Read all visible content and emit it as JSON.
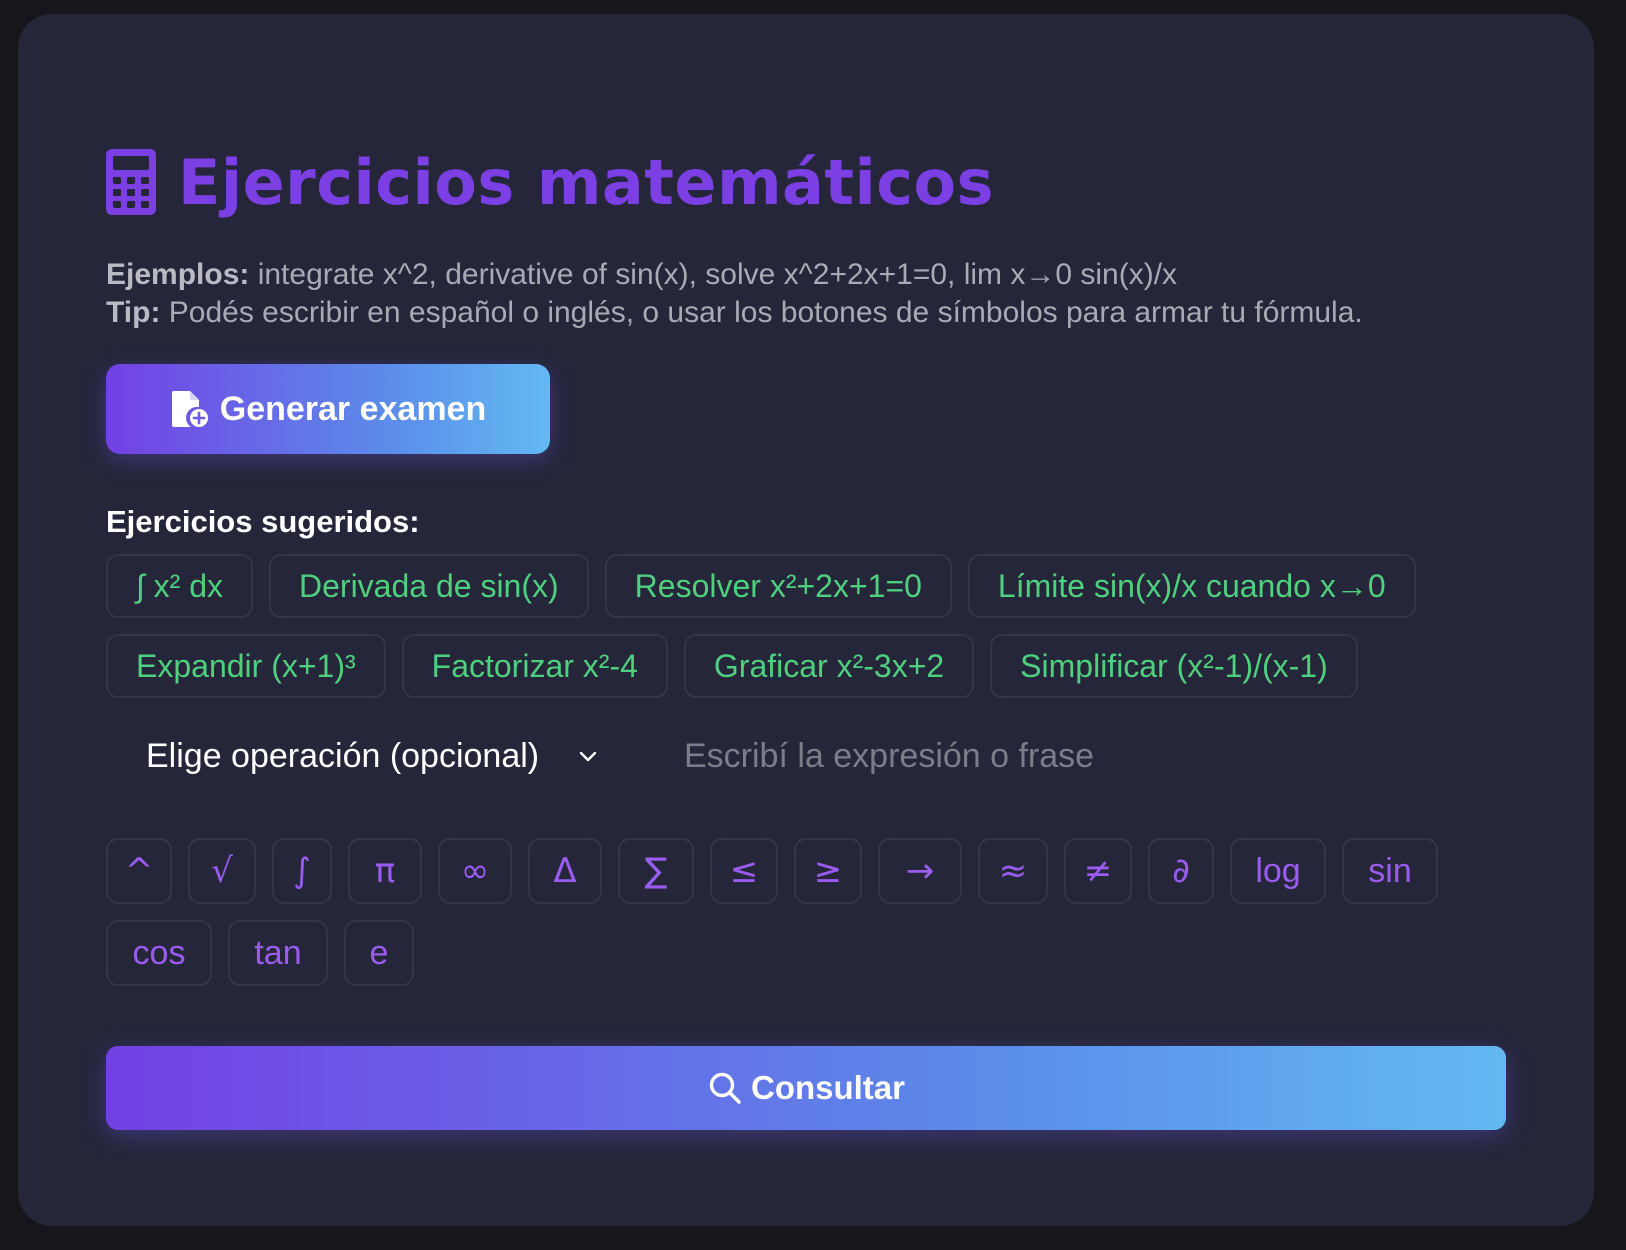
{
  "colors": {
    "background": "#17171b",
    "card": "#25263a",
    "title": "#7b3fe4",
    "chip_text": "#4fd07e",
    "symbol_text": "#9a5cf0",
    "gradient_start": "#7340e4",
    "gradient_end": "#63b9f2"
  },
  "header": {
    "icon": "calculator-icon",
    "title": "Ejercicios matemáticos"
  },
  "info": {
    "examples_label": "Ejemplos:",
    "examples_text": " integrate x^2, derivative of sin(x), solve x^2+2x+1=0, lim x→0 sin(x)/x",
    "tip_label": "Tip:",
    "tip_text": " Podés escribir en español o inglés, o usar los botones de símbolos para armar tu fórmula."
  },
  "generate_button": {
    "icon": "file-plus-icon",
    "label": "Generar examen"
  },
  "suggested": {
    "label": "Ejercicios sugeridos:",
    "row1": [
      "∫ x² dx",
      "Derivada de sin(x)",
      "Resolver x²+2x+1=0",
      "Límite sin(x)/x cuando x→0"
    ],
    "row2": [
      "Expandir (x+1)³",
      "Factorizar x²-4",
      "Graficar x²-3x+2",
      "Simplificar (x²-1)/(x-1)"
    ]
  },
  "operation_select": {
    "selected": "Elige operación (opcional)",
    "icon": "chevron-down-icon"
  },
  "expression_input": {
    "value": "",
    "placeholder": "Escribí la expresión o frase"
  },
  "symbols": {
    "row1": [
      "^",
      "√",
      "∫",
      "π",
      "∞",
      "Δ",
      "∑",
      "≤",
      "≥",
      "→",
      "≈",
      "≠",
      "∂",
      "log",
      "sin"
    ],
    "row2": [
      "cos",
      "tan",
      "e"
    ]
  },
  "consult_button": {
    "icon": "search-icon",
    "label": "Consultar"
  }
}
